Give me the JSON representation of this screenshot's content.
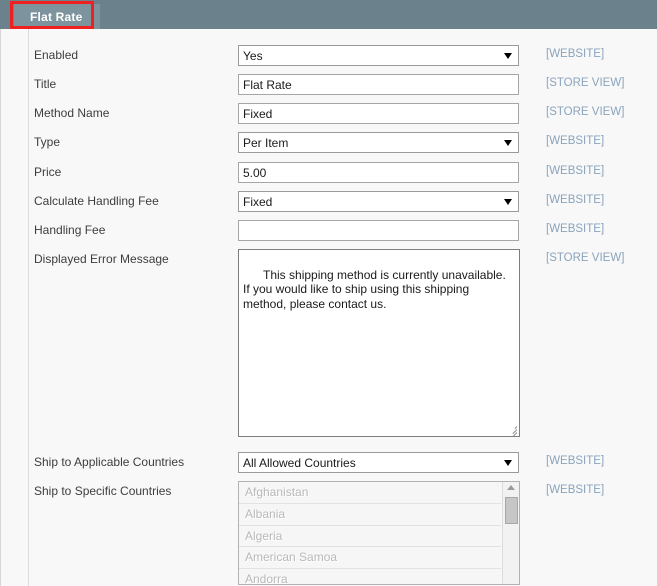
{
  "header": {
    "section_tab_label": "Flat Rate",
    "bar_color": "#6b828c",
    "tab_color": "#7d949e",
    "annotation_color": "#ee2020"
  },
  "form": {
    "rows": [
      {
        "label": "Enabled",
        "type": "select",
        "value": "Yes",
        "scope": "[WEBSITE]"
      },
      {
        "label": "Title",
        "type": "text",
        "value": "Flat Rate",
        "scope": "[STORE VIEW]"
      },
      {
        "label": "Method Name",
        "type": "text",
        "value": "Fixed",
        "scope": "[STORE VIEW]"
      },
      {
        "label": "Type",
        "type": "select",
        "value": "Per Item",
        "scope": "[WEBSITE]"
      },
      {
        "label": "Price",
        "type": "text",
        "value": "5.00",
        "scope": "[WEBSITE]"
      },
      {
        "label": "Calculate Handling Fee",
        "type": "select",
        "value": "Fixed",
        "scope": "[WEBSITE]"
      },
      {
        "label": "Handling Fee",
        "type": "text",
        "value": "",
        "scope": "[WEBSITE]"
      },
      {
        "label": "Displayed Error Message",
        "type": "textarea",
        "value": "This shipping method is currently unavailable. If you would like to ship using this shipping method, please contact us.",
        "scope": "[STORE VIEW]"
      },
      {
        "label": "Ship to Applicable Countries",
        "type": "select",
        "value": "All Allowed Countries",
        "scope": "[WEBSITE]"
      },
      {
        "label": "Ship to Specific Countries",
        "type": "listbox",
        "value": "",
        "scope": "[WEBSITE]"
      }
    ],
    "country_options": [
      "Afghanistan",
      "Albania",
      "Algeria",
      "American Samoa",
      "Andorra"
    ]
  }
}
